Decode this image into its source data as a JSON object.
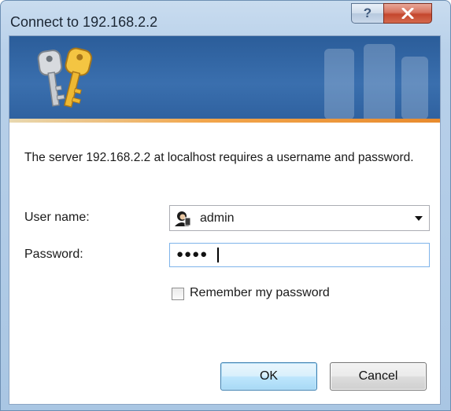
{
  "window": {
    "title": "Connect to 192.168.2.2",
    "help_label": "?",
    "close_icon": "close-icon"
  },
  "dialog": {
    "message": "The server 192.168.2.2 at localhost requires a username and password.",
    "username_label": "User name:",
    "username_value": "admin",
    "password_label": "Password:",
    "password_masked": "●●●●",
    "remember_label": "Remember my password",
    "remember_checked": false,
    "ok_label": "OK",
    "cancel_label": "Cancel"
  },
  "icons": {
    "banner": "keys-icon",
    "user": "user-account-icon",
    "dropdown": "chevron-down-icon"
  }
}
